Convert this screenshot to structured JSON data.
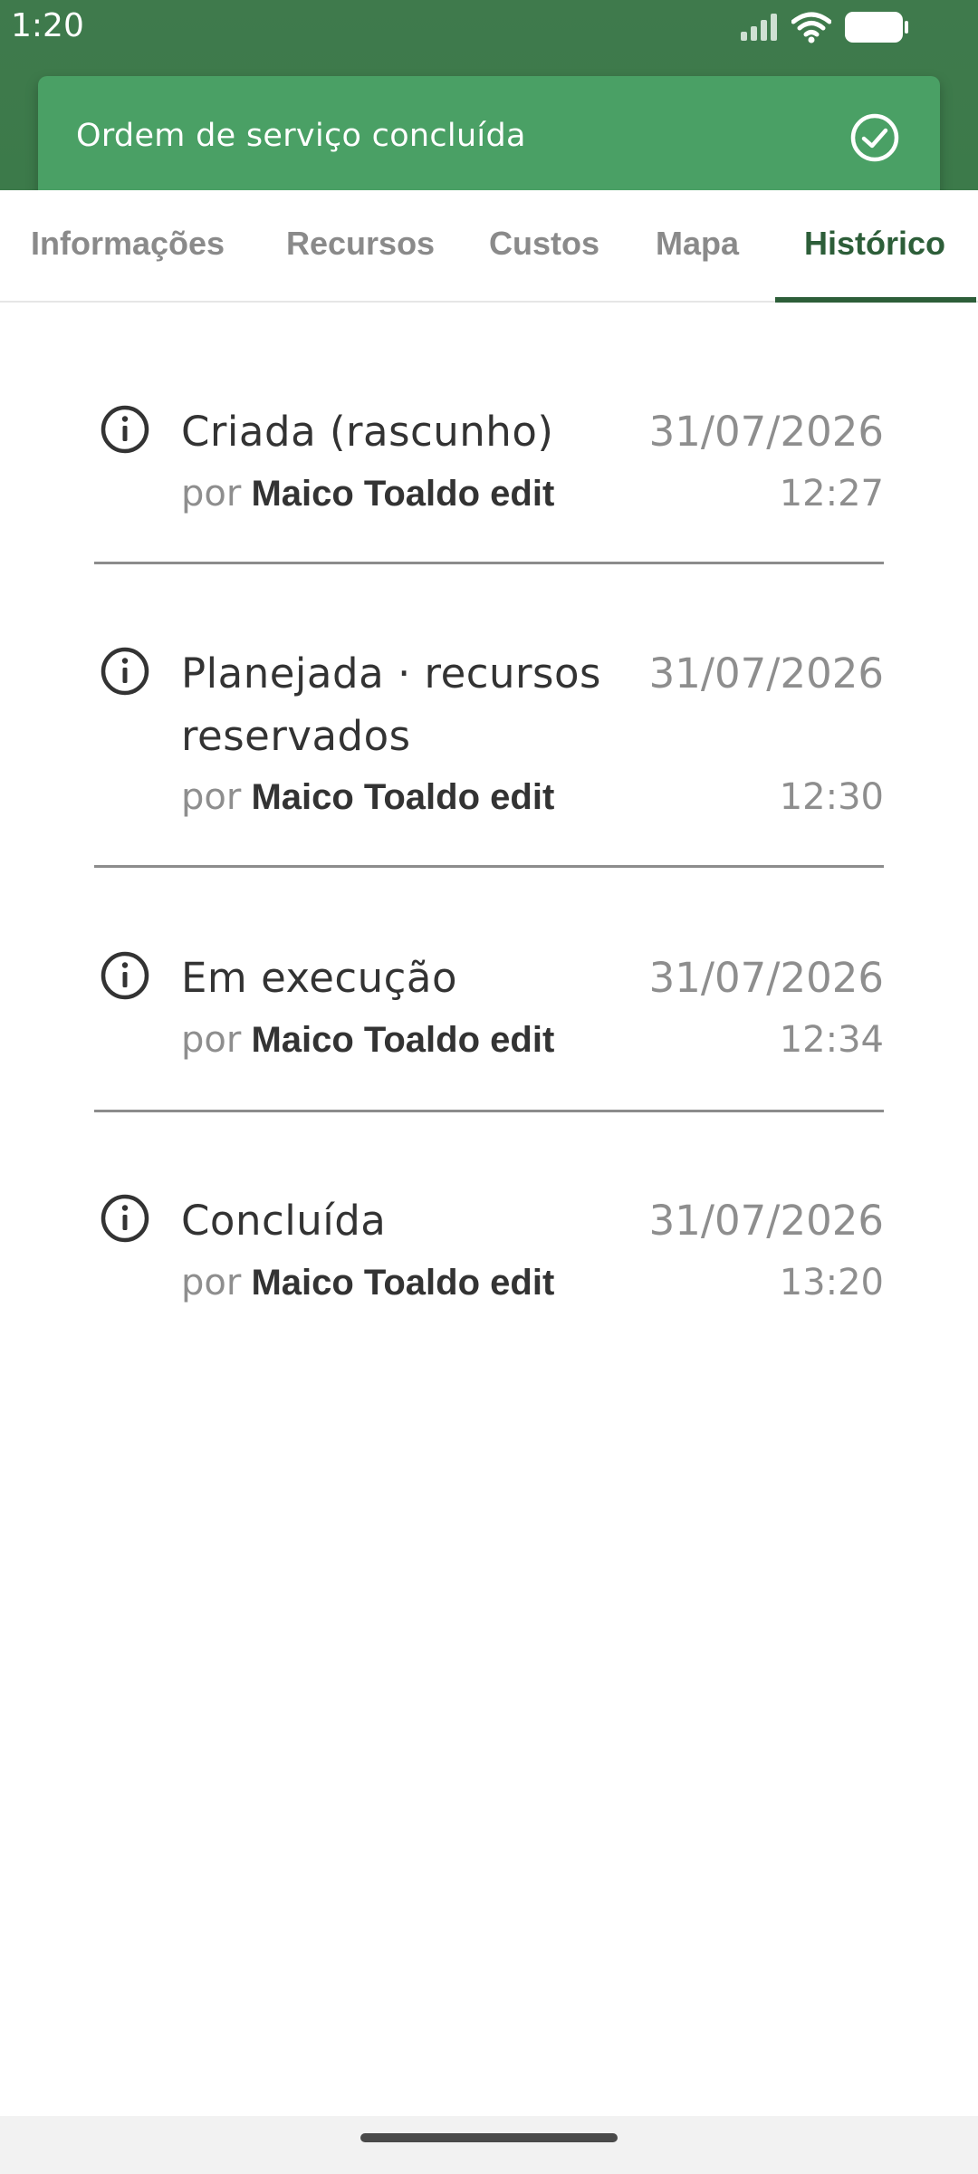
{
  "status_bar": {
    "time": "1:20",
    "icons": [
      "signal-icon",
      "wifi-icon",
      "battery-icon"
    ]
  },
  "toast": {
    "message": "Ordem de serviço concluída",
    "icon": "check-circle-icon",
    "color": "#4aa065"
  },
  "tabs": [
    {
      "label": "Informações",
      "active": false
    },
    {
      "label": "Recursos",
      "active": false
    },
    {
      "label": "Custos",
      "active": false
    },
    {
      "label": "Mapa",
      "active": false
    },
    {
      "label": "Histórico",
      "active": true
    }
  ],
  "history": {
    "by_prefix": "por",
    "entries": [
      {
        "title": "Criada (rascunho)",
        "date": "31/07/2026",
        "time": "12:27",
        "user": "Maico Toaldo edit",
        "icon": "info-icon"
      },
      {
        "title": "Planejada · recursos reservados",
        "date": "31/07/2026",
        "time": "12:30",
        "user": "Maico Toaldo edit",
        "icon": "info-icon"
      },
      {
        "title": "Em execução",
        "date": "31/07/2026",
        "time": "12:34",
        "user": "Maico Toaldo edit",
        "icon": "info-icon"
      },
      {
        "title": "Concluída",
        "date": "31/07/2026",
        "time": "13:20",
        "user": "Maico Toaldo edit",
        "icon": "info-icon"
      }
    ]
  },
  "colors": {
    "header_green": "#3c7a4a",
    "accent_green": "#2d5e39",
    "toast_green": "#4aa065"
  }
}
